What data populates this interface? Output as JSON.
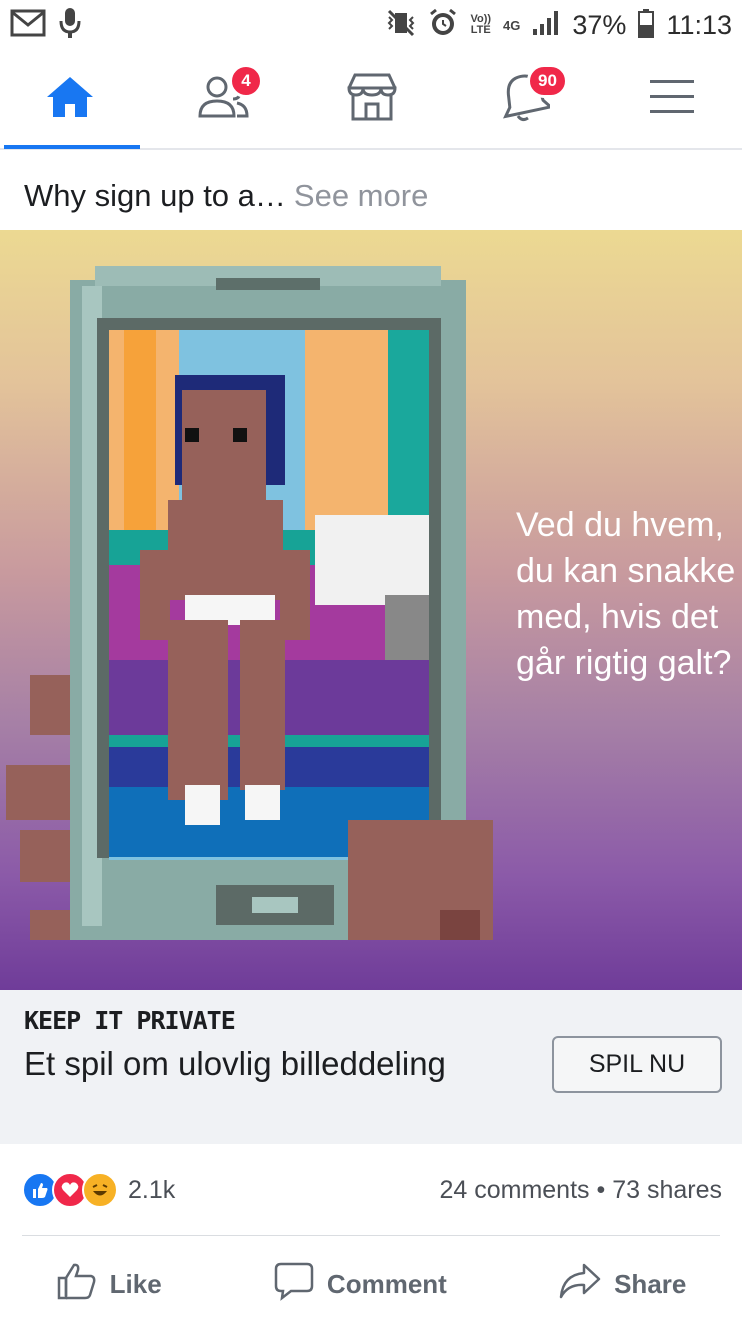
{
  "status_bar": {
    "battery": "37%",
    "time": "11:13",
    "network": "4G",
    "volte_top": "Vo))",
    "volte_bottom": "LTE"
  },
  "nav": {
    "friends_badge": "4",
    "notifications_badge": "90",
    "accent": "#1877f2"
  },
  "post": {
    "text": "Why sign up to a…",
    "see_more": "See more"
  },
  "ad": {
    "caption": "Ved du hvem, du kan snakke med, hvis det går rigtig galt?"
  },
  "cta": {
    "brand": "KEEP IT PRIVATE",
    "subtitle": "Et spil om ulovlig billeddeling",
    "button": "SPIL NU"
  },
  "reactions": {
    "count": "2.1k",
    "comments": "24 comments",
    "separator": "•",
    "shares": "73 shares"
  },
  "actions": {
    "like": "Like",
    "comment": "Comment",
    "share": "Share"
  }
}
